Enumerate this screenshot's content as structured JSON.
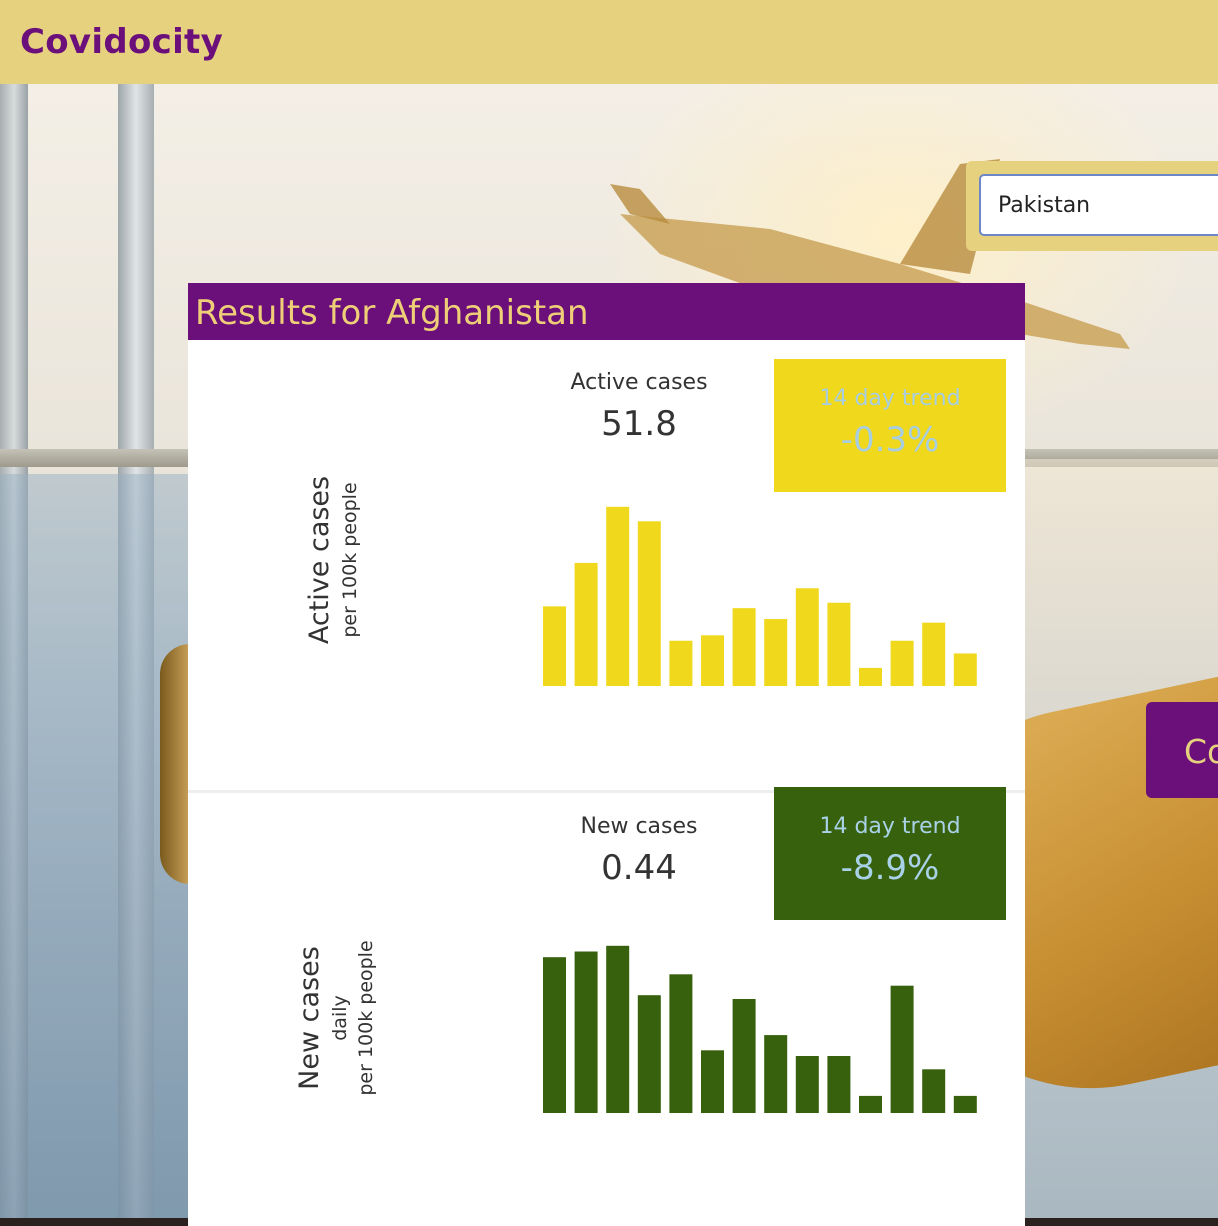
{
  "app": {
    "title": "Covidocity"
  },
  "search": {
    "value": "Pakistan"
  },
  "side_button": {
    "label": "Co"
  },
  "results": {
    "title": "Results for Afghanistan",
    "active": {
      "axis_title": "Active cases",
      "axis_subtitle": "per 100k people",
      "stat_label": "Active cases",
      "stat_value": "51.8",
      "trend_label": "14 day trend",
      "trend_value": "-0.3%",
      "trend_color": "#f0d81d",
      "bar_color": "#f0d81d"
    },
    "new": {
      "axis_title": "New cases",
      "axis_subtitle_1": "daily",
      "axis_subtitle_2": "per 100k people",
      "stat_label": "New cases",
      "stat_value": "0.44",
      "trend_label": "14 day trend",
      "trend_value": "-8.9%",
      "trend_color": "#37610d",
      "bar_color": "#37610d"
    }
  },
  "chart_data": [
    {
      "type": "bar",
      "series": [
        {
          "values": [
            44,
            68,
            99,
            91,
            25,
            28,
            43,
            37,
            54,
            46,
            10,
            25,
            35,
            18
          ]
        }
      ],
      "ylim": [
        0,
        100
      ]
    },
    {
      "type": "bar",
      "series": [
        {
          "values": [
            82,
            85,
            88,
            62,
            73,
            33,
            60,
            41,
            30,
            30,
            9,
            67,
            23,
            9
          ]
        }
      ],
      "ylim": [
        0,
        100
      ]
    }
  ]
}
